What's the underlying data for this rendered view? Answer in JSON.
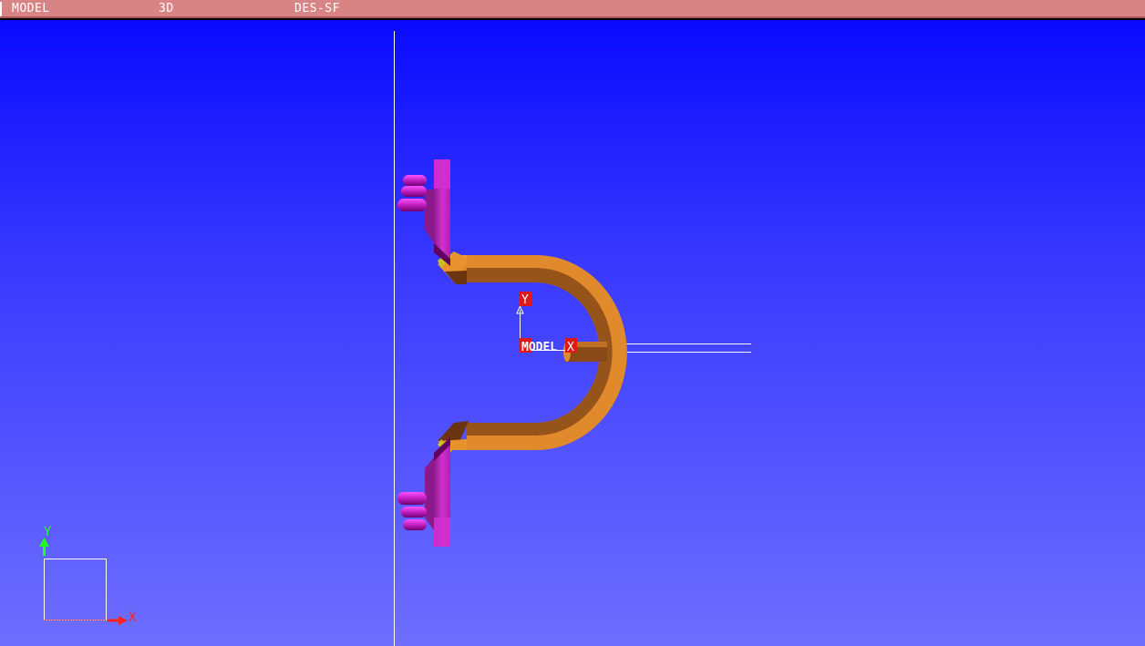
{
  "status_bar": {
    "mode": "MODEL",
    "view": "3D",
    "layer": "DES-SF"
  },
  "model_axis": {
    "x_label": "X",
    "y_label": "Y",
    "origin_label": "MODEL"
  },
  "view_triad": {
    "x_label": "X",
    "y_label": "Y"
  },
  "colors": {
    "background_top": "#0a0aff",
    "background_bottom": "#6e6eff",
    "status_bar": "#d98484",
    "pipe": "#e08a2c",
    "pipe_shadow": "#7a3f14",
    "support": "#c020c0",
    "axis_x": "#ff2020",
    "axis_y": "#20ff20"
  }
}
